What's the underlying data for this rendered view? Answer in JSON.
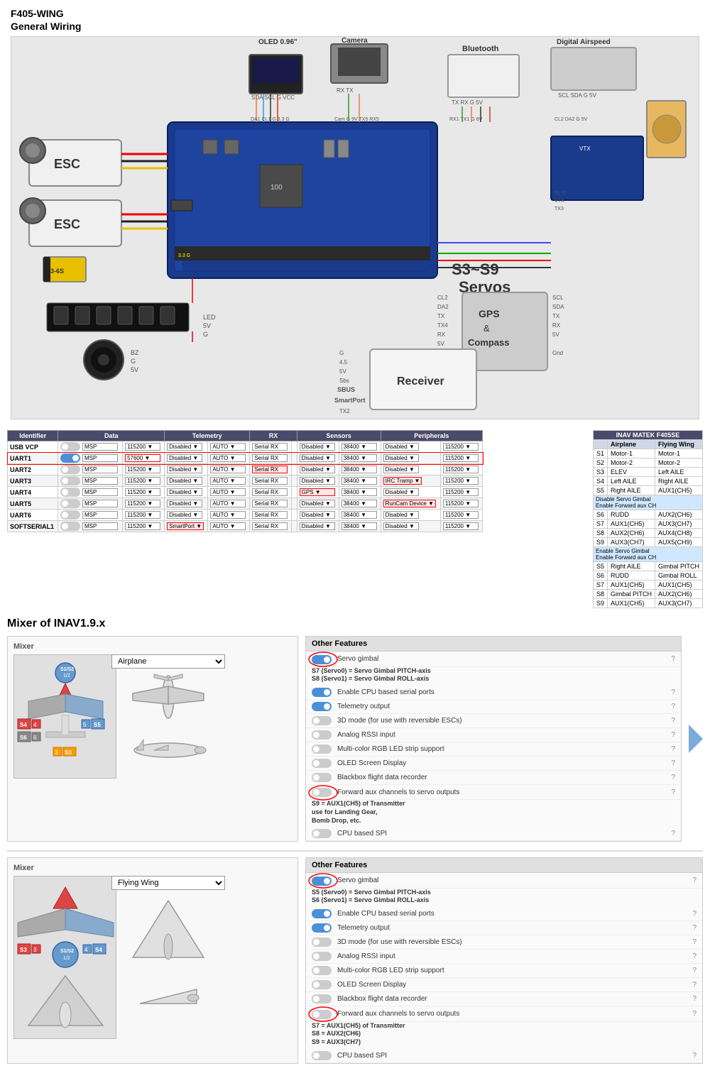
{
  "title": "F405-WING\nGeneral Wiring",
  "wiring": {
    "components": {
      "oled": "OLED 0.96\"",
      "camera": "Camera",
      "bluetooth": "Bluetooth",
      "digital_airspeed": "Digital Airspeed",
      "gps_compass": "GPS\n&\nCompass",
      "receiver": "Receiver",
      "esc1": "ESC",
      "esc2": "ESC",
      "s3_s9": "S3~S9\nServos"
    },
    "pins": {
      "oled": "SDA SCL G VCC",
      "camera": "RX TX",
      "bluetooth_pins": "TX RX G 5V",
      "digital_airspeed_pins": "SCL SDA G 5V",
      "gps_pins": "SCL SDA TX TX4 RX 5V G Gnd",
      "receiver_pins": "G 4.5 5V Sbs SBUS SmartPort TX2"
    }
  },
  "uart_table": {
    "headers": [
      "Identifier",
      "Data",
      "",
      "Telemetry",
      "",
      "RX",
      "",
      "Sensors",
      "",
      "Peripherals",
      ""
    ],
    "rows": [
      {
        "id": "USB VCP",
        "toggle": false,
        "data": "MSP",
        "data_speed": "115200",
        "telemetry": "Disabled",
        "telemetry_mode": "AUTO",
        "rx_type": "Serial RX",
        "sensors": "Disabled",
        "sensors_speed": "38400",
        "peripherals": "Disabled",
        "peripherals_speed": "115200",
        "highlighted": false
      },
      {
        "id": "UART1",
        "toggle": true,
        "data": "MSP",
        "data_speed": "57600",
        "telemetry": "Disabled",
        "telemetry_mode": "AUTO",
        "rx_type": "Serial RX",
        "sensors": "Disabled",
        "sensors_speed": "38400",
        "peripherals": "Disabled",
        "peripherals_speed": "115200",
        "highlighted": true
      },
      {
        "id": "UART2",
        "toggle": false,
        "data": "MSP",
        "data_speed": "115200",
        "telemetry": "Disabled",
        "telemetry_mode": "AUTO",
        "rx_type": "Serial RX",
        "sensors": "Disabled",
        "sensors_speed": "38400",
        "peripherals": "Disabled",
        "peripherals_speed": "115200",
        "highlighted": true
      },
      {
        "id": "UART3",
        "toggle": false,
        "data": "MSP",
        "data_speed": "115200",
        "telemetry": "Disabled",
        "telemetry_mode": "AUTO",
        "rx_type": "Serial RX",
        "sensors": "Disabled",
        "sensors_speed": "38400",
        "peripherals": "IRC Tramp",
        "peripherals_speed": "115200",
        "highlighted": false
      },
      {
        "id": "UART4",
        "toggle": false,
        "data": "MSP",
        "data_speed": "115200",
        "telemetry": "Disabled",
        "telemetry_mode": "AUTO",
        "rx_type": "Serial RX",
        "sensors": "GPS",
        "sensors_speed": "38400",
        "peripherals": "Disabled",
        "peripherals_speed": "115200",
        "highlighted": false
      },
      {
        "id": "UART5",
        "toggle": false,
        "data": "MSP",
        "data_speed": "115200",
        "telemetry": "Disabled",
        "telemetry_mode": "AUTO",
        "rx_type": "Serial RX",
        "sensors": "Disabled",
        "sensors_speed": "38400",
        "peripherals": "RunCam Device",
        "peripherals_speed": "115200",
        "highlighted": false
      },
      {
        "id": "UART6",
        "toggle": false,
        "data": "MSP",
        "data_speed": "115200",
        "telemetry": "Disabled",
        "telemetry_mode": "AUTO",
        "rx_type": "Serial RX",
        "sensors": "Disabled",
        "sensors_speed": "38400",
        "peripherals": "Disabled",
        "peripherals_speed": "115200",
        "highlighted": false
      },
      {
        "id": "SOFTSERIAL1",
        "toggle": false,
        "data": "MSP",
        "data_speed": "115200",
        "telemetry": "SmartPort",
        "telemetry_mode": "AUTO",
        "rx_type": "Serial RX",
        "sensors": "Disabled",
        "sensors_speed": "38400",
        "peripherals": "Disabled",
        "peripherals_speed": "115200",
        "highlighted": false
      }
    ]
  },
  "inav_table": {
    "header": "INAV MATEK F405SE",
    "col_headers": [
      "",
      "Airplane",
      "Flying Wing"
    ],
    "rows": [
      {
        "label": "S1",
        "airplane": "Motor-1",
        "flying_wing": "Motor-1"
      },
      {
        "label": "S2",
        "airplane": "Motor-2",
        "flying_wing": "Motor-2"
      },
      {
        "label": "S3",
        "airplane": "ELEV",
        "flying_wing": "Left AILE"
      },
      {
        "label": "S4",
        "airplane": "Left AILE",
        "flying_wing": "Right AILE"
      },
      {
        "label": "S5",
        "airplane": "Right AILE",
        "flying_wing": "AUX1(CH5)"
      },
      {
        "label": "S6",
        "airplane": "RUDD",
        "flying_wing": "AUX2(CH6)"
      },
      {
        "label": "S7",
        "airplane": "AUX1(CH5)",
        "flying_wing": "AUX3(CH7)"
      },
      {
        "label": "S8",
        "airplane": "AUX2(CH6)",
        "flying_wing": "AUX4(CH8)"
      },
      {
        "label": "S9",
        "airplane": "AUX3(CH7)",
        "flying_wing": "AUX5(CH9)"
      }
    ],
    "disable_note": "Disable Servo Gimbal\nEnable Forward aux CH",
    "disable_s56": [
      {
        "label": "S5",
        "airplane": "Right AILE",
        "flying_wing": "Gimbal PITCH"
      },
      {
        "label": "S6",
        "airplane": "RUDD",
        "flying_wing": "Gimbal ROLL"
      }
    ],
    "enable_note": "Enable Servo Gimbal\nEnable Forward aux CH",
    "enable_rows": [
      {
        "label": "S7",
        "airplane": "AUX1(CH5)",
        "flying_wing": "AUX1(CH5)"
      },
      {
        "label": "S8",
        "airplane": "Gimbal PITCH",
        "flying_wing": "AUX2(CH6)"
      },
      {
        "label": "S9",
        "airplane": "AUX1(CH5)",
        "flying_wing": "AUX3(CH7)"
      }
    ]
  },
  "mixer_airplane": {
    "section_title": "Mixer of INAV1.9.x",
    "mixer_label": "Mixer",
    "dropdown_label": "Airplane",
    "servos": {
      "s1s2": "S1/S2",
      "s4": "S4",
      "s5": "S5",
      "s6": "S6",
      "s3": "S3",
      "num_4": "4",
      "num_5": "5",
      "num_6": "6",
      "num_3": "3",
      "frac_12": "1/2"
    },
    "features_header": "Other Features",
    "features": [
      {
        "label": "Servo gimbal",
        "enabled": true,
        "circled": true
      },
      {
        "label": "Enable CPU based serial ports",
        "enabled": true,
        "circled": false
      },
      {
        "label": "Telemetry output",
        "enabled": true,
        "circled": false
      },
      {
        "label": "3D mode (for use with reversible ESCs)",
        "enabled": false,
        "circled": false
      },
      {
        "label": "Analog RSSI input",
        "enabled": false,
        "circled": false
      },
      {
        "label": "Multi-color RGB LED strip support",
        "enabled": false,
        "circled": false
      },
      {
        "label": "OLED Screen Display",
        "enabled": false,
        "circled": false
      },
      {
        "label": "Blackbox flight data recorder",
        "enabled": false,
        "circled": false
      },
      {
        "label": "Forward aux channels to servo outputs",
        "enabled": false,
        "circled": true
      },
      {
        "label": "CPU based SPI",
        "enabled": false,
        "circled": false
      }
    ],
    "servo_note": "S7 (Servo0) = Servo Gimbal PITCH-axis\nS8 (Servo1) = Servo Gimbal ROLL-axis",
    "aux_note": "S9 = AUX1(CH5) of Transmitter\nuse for Landing Gear,\nBomb Drop, etc."
  },
  "mixer_flying_wing": {
    "mixer_label": "Mixer",
    "dropdown_label": "Flying Wing",
    "servos": {
      "s3": "S3",
      "s4": "S4",
      "s1s2": "S1/S2",
      "num_3": "3",
      "num_4": "4",
      "frac_12": "1/2"
    },
    "features_header": "Other Features",
    "features": [
      {
        "label": "Servo gimbal",
        "enabled": true,
        "circled": true
      },
      {
        "label": "Enable CPU based serial ports",
        "enabled": true,
        "circled": false
      },
      {
        "label": "Telemetry output",
        "enabled": true,
        "circled": false
      },
      {
        "label": "3D mode (for use with reversible ESCs)",
        "enabled": false,
        "circled": false
      },
      {
        "label": "Analog RSSI input",
        "enabled": false,
        "circled": false
      },
      {
        "label": "Multi-color RGB LED strip support",
        "enabled": false,
        "circled": false
      },
      {
        "label": "OLED Screen Display",
        "enabled": false,
        "circled": false
      },
      {
        "label": "Blackbox flight data recorder",
        "enabled": false,
        "circled": false
      },
      {
        "label": "Forward aux channels to servo outputs",
        "enabled": false,
        "circled": true
      },
      {
        "label": "CPU based SPI",
        "enabled": false,
        "circled": false
      }
    ],
    "servo_note": "S5 (Servo0) = Servo Gimbal PITCH-axis\nS6 (Servo1) = Servo Gimbal ROLL-axis",
    "aux_note": "S7 = AUX1(CH5) of Transmitter\nS8 = AUX2(CH6)\nS9 = AUX3(CH7)"
  }
}
